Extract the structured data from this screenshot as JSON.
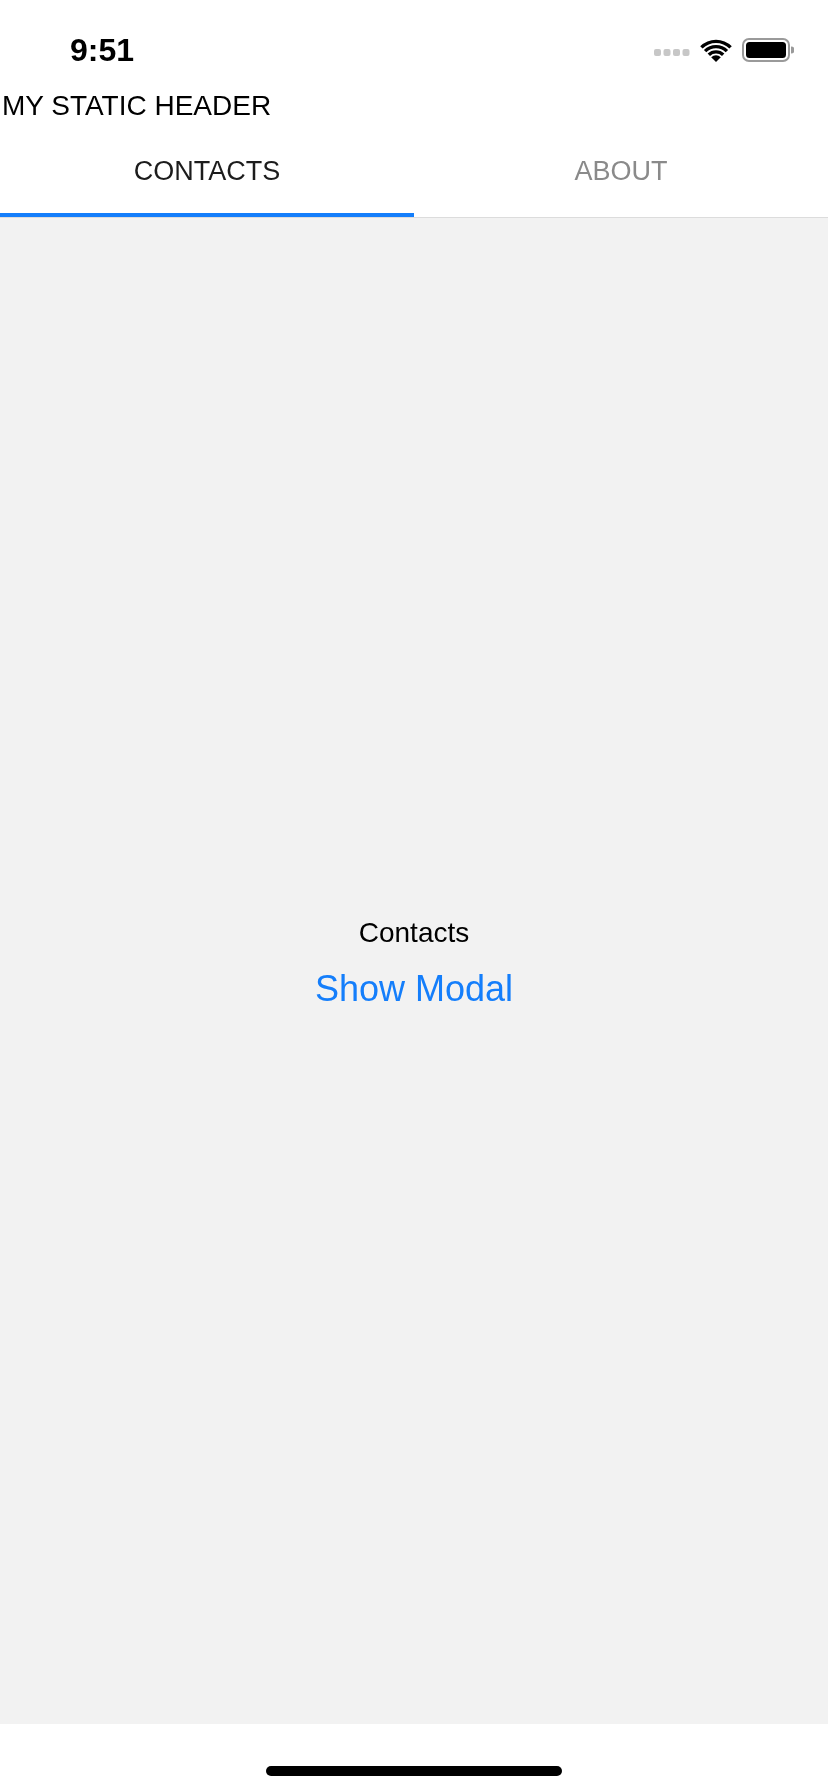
{
  "status_bar": {
    "time": "9:51"
  },
  "header": {
    "title": "MY STATIC HEADER"
  },
  "tabs": [
    {
      "label": "CONTACTS",
      "selected": true
    },
    {
      "label": "ABOUT",
      "selected": false
    }
  ],
  "content": {
    "title": "Contacts",
    "button": "Show Modal"
  }
}
